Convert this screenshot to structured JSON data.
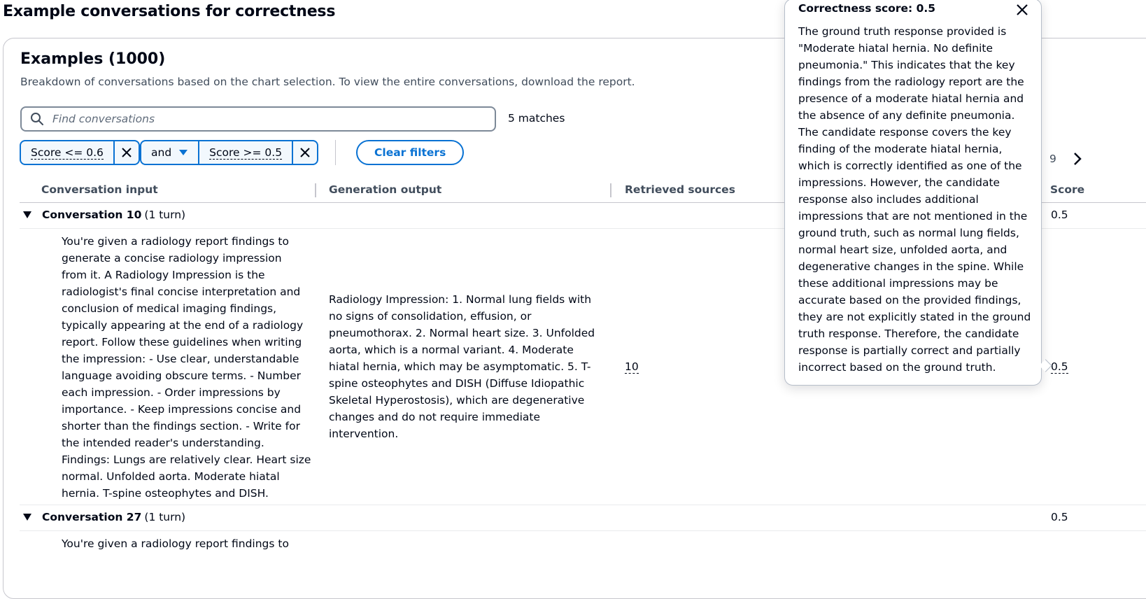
{
  "page": {
    "title": "Example conversations for correctness"
  },
  "examples": {
    "heading": "Examples (1000)",
    "description": "Breakdown of conversations based on the chart selection. To view the entire conversations, download the report.",
    "search_placeholder": "Find conversations",
    "matches": "5 matches"
  },
  "filters": {
    "token1": "Score <= 0.6",
    "operator": "and",
    "token2": "Score >= 0.5",
    "clear_label": "Clear filters"
  },
  "pagination": {
    "page_label": "9"
  },
  "table": {
    "columns": [
      "Conversation input",
      "Generation output",
      "Retrieved sources",
      "Score"
    ],
    "groups": [
      {
        "title": "Conversation 10",
        "turns": "(1 turn)",
        "score": "0.5"
      },
      {
        "title": "Conversation 27",
        "turns": "(1 turn)",
        "score": "0.5"
      }
    ],
    "row1": {
      "input_lines": [
        "You're given a radiology report findings to",
        "generate a concise radiology impression",
        "from it. A Radiology Impression is the",
        "radiologist's final concise interpretation and",
        "conclusion of medical imaging findings,",
        "typically appearing at the end of a radiology",
        "report. Follow these guidelines when writing",
        "the impression: - Use clear, understandable",
        "language avoiding obscure terms. - Number",
        "each impression. - Order impressions by",
        "importance. - Keep impressions concise and",
        "shorter than the findings section. - Write for",
        "the intended reader's understanding.",
        "Findings: Lungs are relatively clear. Heart size",
        "normal. Unfolded aorta. Moderate hiatal",
        "hernia. T-spine osteophytes and DISH."
      ],
      "output_lines": [
        "Radiology Impression: 1. Normal lung fields with",
        "no signs of consolidation, effusion, or",
        "pneumothorax. 2. Normal heart size. 3. Unfolded",
        "aorta, which is a normal variant. 4. Moderate",
        "hiatal hernia, which may be asymptomatic. 5. T-",
        "spine osteophytes and DISH (Diffuse Idiopathic",
        "Skeletal Hyperostosis), which are degenerative",
        "changes and do not require immediate",
        "intervention."
      ],
      "sources": "10",
      "score": "0.5"
    },
    "row2_partial": "You're given a radiology report findings to"
  },
  "popover": {
    "title": "Correctness score: 0.5",
    "lines": [
      "The ground truth response provided is",
      "\"Moderate hiatal hernia. No definite",
      "pneumonia.\" This indicates that the key",
      "findings from the radiology report are the",
      "presence of a moderate hiatal hernia and",
      "the absence of any definite pneumonia.",
      "The candidate response covers the key",
      "finding of the moderate hiatal hernia,",
      "which is correctly identified as one of the",
      "impressions. However, the candidate",
      "response also includes additional",
      "impressions that are not mentioned in the",
      "ground truth, such as normal lung fields,",
      "normal heart size, unfolded aorta, and",
      "degenerative changes in the spine. While",
      "these additional impressions may be",
      "accurate based on the provided findings,",
      "they are not explicitly stated in the ground",
      "truth response. Therefore, the candidate",
      "response is partially correct and partially",
      "incorrect based on the ground truth."
    ]
  },
  "icons": {
    "search": "search-icon",
    "close": "close-icon",
    "caret": "caret-down-icon",
    "expand": "triangle-down-icon",
    "next": "chevron-right-icon"
  },
  "colors": {
    "accent": "#0972d3",
    "text": "#000716",
    "muted": "#414d5c",
    "border": "#c6c6cd"
  }
}
